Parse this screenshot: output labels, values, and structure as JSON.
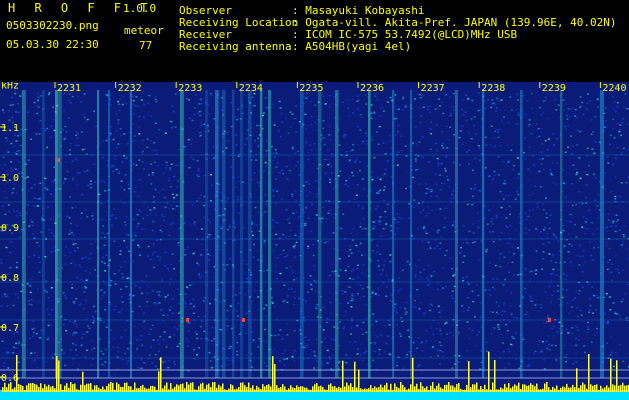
{
  "app": {
    "name": "H R O F F T",
    "version": "1.0.0",
    "filename": "0503302230.png",
    "mode": "meteor",
    "datetime": "05.03.30 22:30",
    "count": "77"
  },
  "station": [
    {
      "label": "Observer",
      "value": ": Masayuki Kobayashi"
    },
    {
      "label": "Receiving Location",
      "value": ": Ogata-vill. Akita-Pref. JAPAN (139.96E, 40.02N)"
    },
    {
      "label": "Receiver",
      "value": ": ICOM IC-575 53.7492(@LCD)MHz USB"
    },
    {
      "label": "Receiving antenna",
      "value": ": A504HB(yagi 4el)"
    }
  ],
  "chart_data": {
    "type": "heatmap",
    "ylabel": "kHz",
    "yticks": [
      "1.1",
      "1.0",
      "0.9",
      "0.8",
      "0.7",
      "0.6"
    ],
    "xticks": [
      "2231",
      "2232",
      "2233",
      "2234",
      "2235",
      "2236",
      "2237",
      "2238",
      "2239",
      "2240"
    ],
    "colors": {
      "background": "#0a1b7a",
      "noise_low": "#1a3fd8",
      "noise_mid": "#1fa0e0",
      "noise_high": "#3fe0c0",
      "signal": "#ffff40",
      "baseline": "#00e0ff",
      "text": "#ffff00"
    }
  }
}
